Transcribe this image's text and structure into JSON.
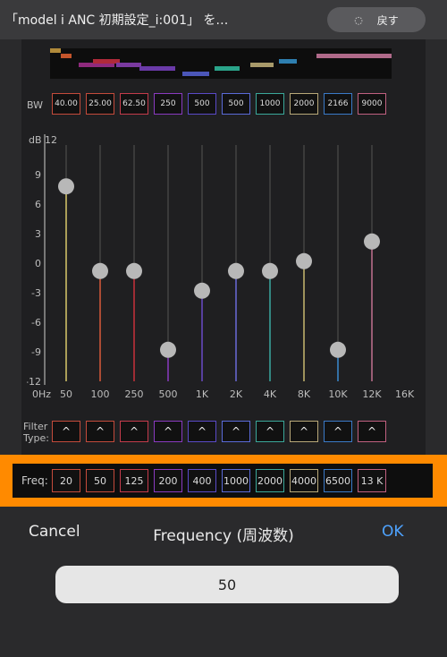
{
  "header": {
    "title": "「model i ANC 初期設定_i:001」 を…",
    "back_label": "戻す",
    "back_icon": "refresh-icon"
  },
  "band_strip": {
    "segments": [
      {
        "color": "#b08a3a"
      },
      {
        "color": "#c4552b"
      },
      {
        "color": "#8f2a7d"
      },
      {
        "color": "#b02a3a"
      },
      {
        "color": "#7a3aa0"
      },
      {
        "color": "#6a3aa8"
      },
      {
        "color": "#4b56b8"
      },
      {
        "color": "#2aa48a"
      },
      {
        "color": "#a89a6a"
      },
      {
        "color": "#2e7fb0"
      },
      {
        "color": "#b06a8a"
      }
    ]
  },
  "bw": {
    "label": "BW",
    "values": [
      "40.00",
      "25.00",
      "62.50",
      "250",
      "500",
      "500",
      "1000",
      "2000",
      "2166",
      "9000"
    ]
  },
  "graph": {
    "y_title": "dB 12",
    "y_ticks": [
      "9",
      "6",
      "3",
      "0",
      "-3",
      "-6",
      "-9",
      "-12"
    ],
    "x_start": "0Hz",
    "x_ticks": [
      "50",
      "100",
      "250",
      "500",
      "1K",
      "2K",
      "4K",
      "8K",
      "10K",
      "12K"
    ],
    "x_end": "16K",
    "bands": [
      {
        "freq": "50",
        "gain": 7.8,
        "color": "#d8c86a"
      },
      {
        "freq": "100",
        "gain": -0.8,
        "color": "#d85a3a"
      },
      {
        "freq": "250",
        "gain": -0.8,
        "color": "#c8303a"
      },
      {
        "freq": "500",
        "gain": -8.8,
        "color": "#8a3ac0"
      },
      {
        "freq": "1K",
        "gain": -2.8,
        "color": "#6a4ac8"
      },
      {
        "freq": "2K",
        "gain": -0.8,
        "color": "#6a6ad8"
      },
      {
        "freq": "4K",
        "gain": -0.8,
        "color": "#3aa8a0"
      },
      {
        "freq": "8K",
        "gain": 0.2,
        "color": "#c8b870"
      },
      {
        "freq": "10K",
        "gain": -8.8,
        "color": "#3a8ad0"
      },
      {
        "freq": "12K",
        "gain": 2.2,
        "color": "#c07090"
      }
    ]
  },
  "filter": {
    "label": "Filter\nType:",
    "symbol": "^"
  },
  "freq": {
    "label": "Freq:",
    "values": [
      "20",
      "50",
      "125",
      "200",
      "400",
      "1000",
      "2000",
      "4000",
      "6500",
      "13 K"
    ]
  },
  "sheet": {
    "cancel": "Cancel",
    "title": "Frequency (周波数)",
    "ok": "OK",
    "value": "50"
  },
  "box_colors": [
    "#c44b3b",
    "#c44b3b",
    "#c43b4b",
    "#8a3ac0",
    "#5a4ac8",
    "#5a6ad8",
    "#3aa89a",
    "#b8a878",
    "#3a7ac8",
    "#c06080"
  ]
}
